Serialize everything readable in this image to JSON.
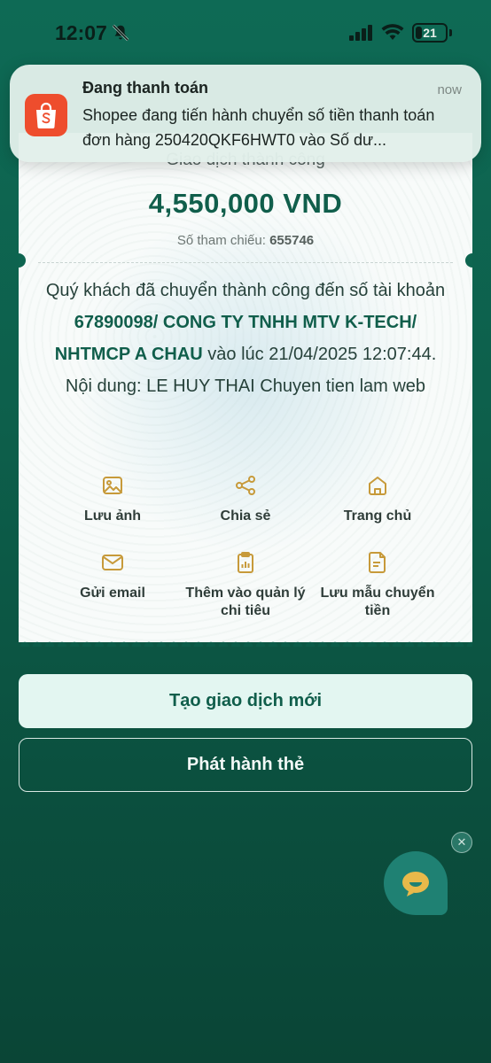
{
  "status_bar": {
    "time": "12:07",
    "battery_level": "21"
  },
  "notification": {
    "app_icon": "shopee-bag-icon",
    "title": "Đang thanh toán",
    "time": "now",
    "body": "Shopee đang tiến hành chuyển số tiền thanh toán đơn hàng 250420QKF6HWT0 vào Số dư..."
  },
  "receipt": {
    "status_title": "Giao dịch thành công",
    "amount": "4,550,000 VND",
    "reference_label": "Số tham chiếu:",
    "reference_value": "655746",
    "message": {
      "prefix": "Quý khách đã chuyển thành công đến số tài khoản ",
      "account_number": "67890098",
      "sep1": "/ ",
      "account_name": "CONG TY TNHH MTV K-TECH",
      "sep2": "/ ",
      "bank": "NHTMCP A CHAU",
      "time_prefix": " vào lúc ",
      "timestamp": "21/04/2025 12:07:44",
      "content_prefix": ". Nội dung: ",
      "content": "LE HUY THAI Chuyen tien lam web"
    },
    "actions": [
      {
        "label": "Lưu ảnh",
        "icon": "image-icon"
      },
      {
        "label": "Chia sẻ",
        "icon": "share-icon"
      },
      {
        "label": "Trang chủ",
        "icon": "home-icon"
      },
      {
        "label": "Gửi email",
        "icon": "mail-icon"
      },
      {
        "label": "Thêm vào quản lý chi tiêu",
        "icon": "clipboard-icon"
      },
      {
        "label": "Lưu mẫu chuyển tiền",
        "icon": "document-icon"
      }
    ]
  },
  "buttons": {
    "new_transaction": "Tạo giao dịch mới",
    "issue_card": "Phát hành thẻ"
  },
  "chat": {
    "icon": "chat-icon",
    "close_icon": "close-icon"
  },
  "colors": {
    "brand_green": "#105e4b",
    "accent_gold": "#c79a3a",
    "shopee_orange": "#ee4d2d"
  }
}
